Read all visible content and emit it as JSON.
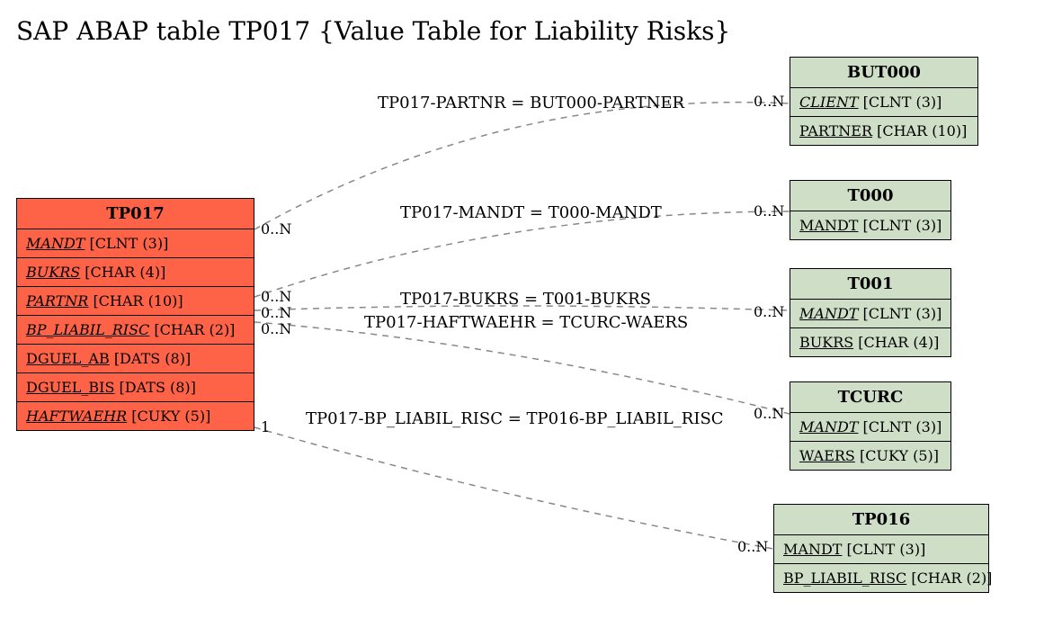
{
  "title": "SAP ABAP table TP017 {Value Table for Liability Risks}",
  "main_table": {
    "name": "TP017",
    "fields": [
      {
        "name": "MANDT",
        "type": "[CLNT (3)]",
        "key": true
      },
      {
        "name": "BUKRS",
        "type": "[CHAR (4)]",
        "key": true
      },
      {
        "name": "PARTNR",
        "type": "[CHAR (10)]",
        "key": true
      },
      {
        "name": "BP_LIABIL_RISC",
        "type": "[CHAR (2)]",
        "key": true
      },
      {
        "name": "DGUEL_AB",
        "type": "[DATS (8)]",
        "key": false
      },
      {
        "name": "DGUEL_BIS",
        "type": "[DATS (8)]",
        "key": false
      },
      {
        "name": "HAFTWAEHR",
        "type": "[CUKY (5)]",
        "key": false
      }
    ]
  },
  "related_tables": [
    {
      "name": "BUT000",
      "fields": [
        {
          "name": "CLIENT",
          "type": "[CLNT (3)]",
          "key": true
        },
        {
          "name": "PARTNER",
          "type": "[CHAR (10)]",
          "key": false
        }
      ]
    },
    {
      "name": "T000",
      "fields": [
        {
          "name": "MANDT",
          "type": "[CLNT (3)]",
          "key": false
        }
      ]
    },
    {
      "name": "T001",
      "fields": [
        {
          "name": "MANDT",
          "type": "[CLNT (3)]",
          "key": true
        },
        {
          "name": "BUKRS",
          "type": "[CHAR (4)]",
          "key": false
        }
      ]
    },
    {
      "name": "TCURC",
      "fields": [
        {
          "name": "MANDT",
          "type": "[CLNT (3)]",
          "key": true
        },
        {
          "name": "WAERS",
          "type": "[CUKY (5)]",
          "key": false
        }
      ]
    },
    {
      "name": "TP016",
      "fields": [
        {
          "name": "MANDT",
          "type": "[CLNT (3)]",
          "key": false
        },
        {
          "name": "BP_LIABIL_RISC",
          "type": "[CHAR (2)]",
          "key": false
        }
      ]
    }
  ],
  "relations": [
    {
      "label": "TP017-PARTNR = BUT000-PARTNER",
      "left_card": "0..N",
      "right_card": "0..N"
    },
    {
      "label": "TP017-MANDT = T000-MANDT",
      "left_card": "0..N",
      "right_card": "0..N"
    },
    {
      "label": "TP017-BUKRS = T001-BUKRS",
      "left_card": "0..N",
      "right_card": "0..N"
    },
    {
      "label": "TP017-HAFTWAEHR = TCURC-WAERS",
      "left_card": "0..N",
      "right_card": "0..N"
    },
    {
      "label": "TP017-BP_LIABIL_RISC = TP016-BP_LIABIL_RISC",
      "left_card": "1",
      "right_card": "0..N"
    }
  ]
}
